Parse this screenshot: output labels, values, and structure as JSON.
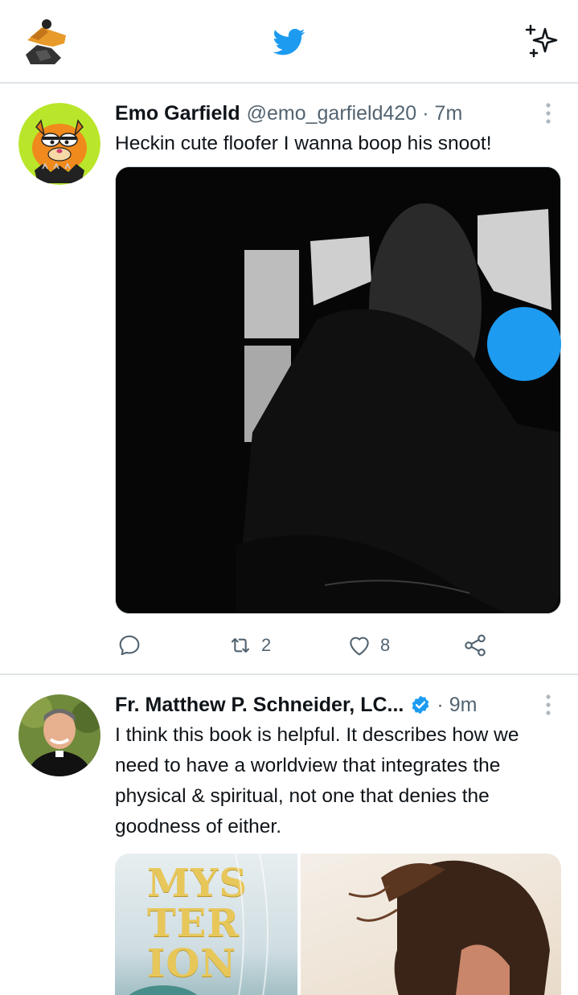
{
  "header": {
    "profile_icon": "profile-avatar-icon",
    "logo_icon": "twitter-bird-icon",
    "sparkle_icon": "sparkle-icon",
    "brand_color": "#1d9bf0"
  },
  "tweets": [
    {
      "name": "Emo Garfield",
      "handle": "@emo_garfield420",
      "dot": "·",
      "time": "7m",
      "text": "Heckin cute floofer I wanna boop his snoot!",
      "actions": {
        "reply": "",
        "retweet": "2",
        "like": "8"
      }
    },
    {
      "name": "Fr. Matthew P. Schneider, LC...",
      "handle": "",
      "dot": "·",
      "time": "9m",
      "verified": true,
      "text": "I think this book is helpful. It describes how we need to have a worldview that integrates the physical & spiritual, not one that denies the goodness of either.",
      "media_text": "MYS TER ION"
    }
  ]
}
